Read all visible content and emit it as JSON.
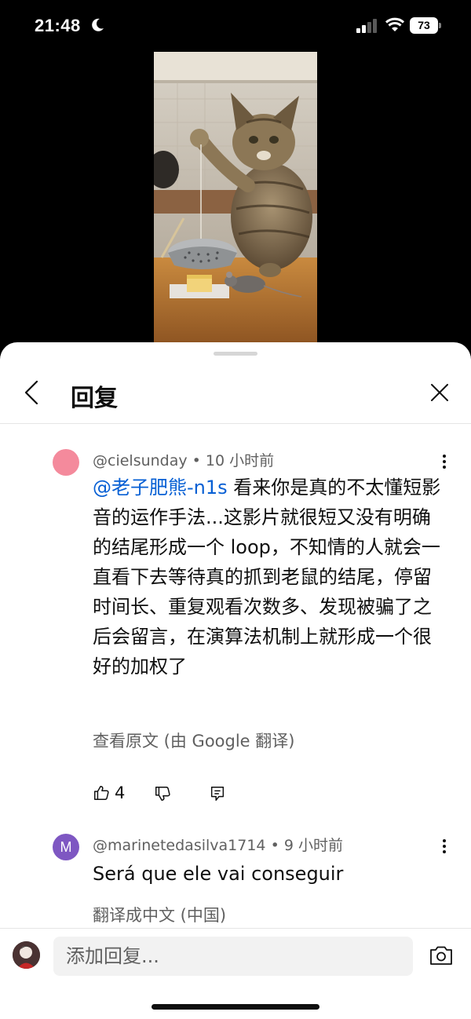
{
  "status_bar": {
    "time": "21:48",
    "battery": "73"
  },
  "sheet": {
    "title": "回复"
  },
  "comments": [
    {
      "author": "@cielsunday",
      "time": "10 小时前",
      "mention": "@老子肥熊-n1s",
      "text": " 看来你是真的不太懂短影音的运作手法...这影片就很短又没有明确的结尾形成一个 loop，不知情的人就会一直看下去等待真的抓到老鼠的结尾，停留时间长、重复观看次数多、发现被骗了之后会留言，在演算法机制上就形成一个很好的加权了",
      "translate_label": "查看原文 (由 Google 翻译)",
      "likes": "4",
      "avatar_color": "#f48a9c"
    },
    {
      "author": "@marinetedasilva1714",
      "time": "9 小时前",
      "avatar_letter": "M",
      "text": "Será que ele vai conseguir",
      "translate_label": "翻译成中文 (中国)",
      "avatar_color": "#7e57c2"
    }
  ],
  "composer": {
    "placeholder": "添加回复..."
  }
}
